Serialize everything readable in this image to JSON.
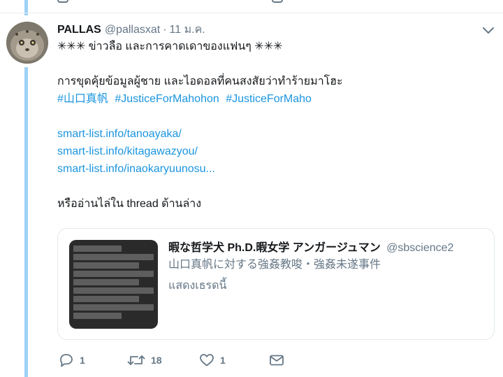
{
  "tweet": {
    "name": "PALLAS",
    "handle": "@pallasxat",
    "separator": "·",
    "time": "11 ม.ค.",
    "lines": [
      "✳✳✳ ข่าวลือ และการคาดเดาของแฟนๆ ✳✳✳",
      "การขุดคุ้ยข้อมูลผู้ชาย และไอดอลที่คนสงสัยว่าทำร้ายมาโฮะ"
    ],
    "hashtags": [
      "#山口真帆",
      "#JusticeForMahohon",
      "#JusticeForMaho"
    ],
    "links": [
      "smart-list.info/tanoayaka/",
      "smart-list.info/kitagawazyou/",
      "smart-list.info/inaokaryuunosu..."
    ],
    "thread_prefix": "หรืออ่านไล่ใน",
    "thread_word": "thread",
    "thread_suffix": "ด้านล่าง"
  },
  "quote_card": {
    "name": "暇な哲学犬 Ph.D.暇女学 アンガージュマン",
    "handle": "@sbscience2",
    "text": "山口真帆に対する強姦教唆・強姦未遂事件",
    "show_thread": "แสดงเธรดนี้"
  },
  "actions": {
    "reply_count": "1",
    "retweet_count": "18",
    "like_count": "1"
  },
  "icons": {
    "reply": "reply-icon",
    "retweet": "retweet-icon",
    "like": "heart-icon",
    "dm": "envelope-icon",
    "caret": "chevron-down-icon"
  },
  "colors": {
    "link": "#1b95e0",
    "thread_line": "#9dd1f7",
    "muted": "#657786"
  }
}
